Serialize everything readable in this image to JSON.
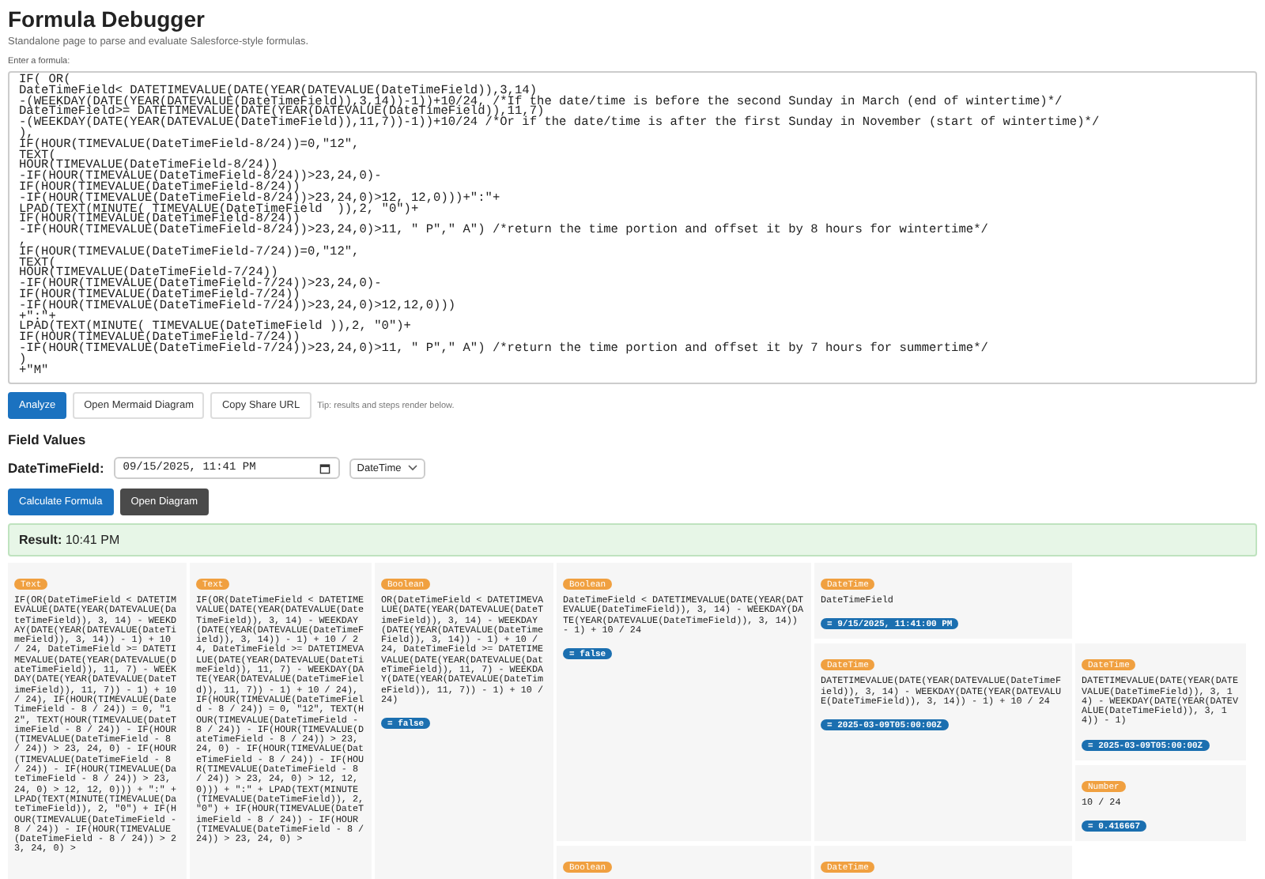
{
  "header": {
    "title": "Formula Debugger",
    "subtitle": "Standalone page to parse and evaluate Salesforce-style formulas."
  },
  "formula": {
    "label": "Enter a formula:",
    "value": "IF( OR(\nDateTimeField< DATETIMEVALUE(DATE(YEAR(DATEVALUE(DateTimeField)),3,14)\n-(WEEKDAY(DATE(YEAR(DATEVALUE(DateTimeField)),3,14))-1))+10/24, /*If the date/time is before the second Sunday in March (end of wintertime)*/\nDateTimeField>= DATETIMEVALUE(DATE(YEAR(DATEVALUE(DateTimeField)),11,7)\n-(WEEKDAY(DATE(YEAR(DATEVALUE(DateTimeField)),11,7))-1))+10/24 /*Or if the date/time is after the first Sunday in November (start of wintertime)*/\n),\nIF(HOUR(TIMEVALUE(DateTimeField-8/24))=0,\"12\",\nTEXT(\nHOUR(TIMEVALUE(DateTimeField-8/24))\n-IF(HOUR(TIMEVALUE(DateTimeField-8/24))>23,24,0)-\nIF(HOUR(TIMEVALUE(DateTimeField-8/24))\n-IF(HOUR(TIMEVALUE(DateTimeField-8/24))>23,24,0)>12, 12,0)))+\":\"+\nLPAD(TEXT(MINUTE( TIMEVALUE(DateTimeField  )),2, \"0\")+\nIF(HOUR(TIMEVALUE(DateTimeField-8/24))\n-IF(HOUR(TIMEVALUE(DateTimeField-8/24))>23,24,0)>11, \" P\",\" A\") /*return the time portion and offset it by 8 hours for wintertime*/\n,\nIF(HOUR(TIMEVALUE(DateTimeField-7/24))=0,\"12\",\nTEXT(\nHOUR(TIMEVALUE(DateTimeField-7/24))\n-IF(HOUR(TIMEVALUE(DateTimeField-7/24))>23,24,0)-\nIF(HOUR(TIMEVALUE(DateTimeField-7/24))\n-IF(HOUR(TIMEVALUE(DateTimeField-7/24))>23,24,0)>12,12,0)))\n+\":\"+\nLPAD(TEXT(MINUTE( TIMEVALUE(DateTimeField )),2, \"0\")+\nIF(HOUR(TIMEVALUE(DateTimeField-7/24))\n-IF(HOUR(TIMEVALUE(DateTimeField-7/24))>23,24,0)>11, \" P\",\" A\") /*return the time portion and offset it by 7 hours for summertime*/\n)\n+\"M\""
  },
  "actions": [
    {
      "label": "Analyze",
      "kind": "primary"
    },
    {
      "label": "Open Mermaid Diagram",
      "kind": "secondary"
    },
    {
      "label": "Copy Share URL",
      "kind": "secondary"
    }
  ],
  "tip": "Tip: results and steps render below.",
  "field_values": {
    "heading": "Field Values",
    "fields": [
      {
        "label": "DateTimeField:",
        "value": "09/15/2025, 11:41 PM",
        "type": "DateTime"
      }
    ]
  },
  "calc_buttons": [
    {
      "label": "Calculate Formula",
      "kind": "primary"
    },
    {
      "label": "Open Diagram",
      "kind": "dark"
    }
  ],
  "result": {
    "label": "Result:",
    "value": "10:41 PM"
  },
  "steps": {
    "type": "Text",
    "expression": "IF(OR(DateTimeField < DATETIMEVALUE(DATE(YEAR(DATEVALUE(DateTimeField)), 3, 14) - WEEKDAY(DATE(YEAR(DATEVALUE(DateTimeField)), 3, 14)) - 1) + 10 / 24, DateTimeField >= DATETIMEVALUE(DATE(YEAR(DATEVALUE(DateTimeField)), 11, 7) - WEEKDAY(DATE(YEAR(DATEVALUE(DateTimeField)), 11, 7)) - 1) + 10 / 24), IF(HOUR(TIMEVALUE(DateTimeField - 8 / 24)) = 0, \"12\", TEXT(HOUR(TIMEVALUE(DateTimeField - 8 / 24)) - IF(HOUR(TIMEVALUE(DateTimeField - 8 / 24)) > 23, 24, 0) - IF(HOUR(TIMEVALUE(DateTimeField - 8 / 24)) - IF(HOUR(TIMEVALUE(DateTimeField - 8 / 24)) > 23, 24, 0) > 12, 12, 0))) + \":\" + LPAD(TEXT(MINUTE(TIMEVALUE(DateTimeField)), 2, \"0\") + IF(HOUR(TIMEVALUE(DateTimeField - 8 / 24)) - IF(HOUR(TIMEVALUE(DateTimeField - 8 / 24)) > 23, 24, 0) >",
    "children": [
      {
        "type": "Text",
        "expression": "IF(OR(DateTimeField < DATETIMEVALUE(DATE(YEAR(DATEVALUE(DateTimeField)), 3, 14) - WEEKDAY(DATE(YEAR(DATEVALUE(DateTimeField)), 3, 14)) - 1) + 10 / 24, DateTimeField >= DATETIMEVALUE(DATE(YEAR(DATEVALUE(DateTimeField)), 11, 7) - WEEKDAY(DATE(YEAR(DATEVALUE(DateTimeField)), 11, 7)) - 1) + 10 / 24), IF(HOUR(TIMEVALUE(DateTimeField - 8 / 24)) = 0, \"12\", TEXT(HOUR(TIMEVALUE(DateTimeField - 8 / 24)) - IF(HOUR(TIMEVALUE(DateTimeField - 8 / 24)) > 23, 24, 0) - IF(HOUR(TIMEVALUE(DateTimeField - 8 / 24)) - IF(HOUR(TIMEVALUE(DateTimeField - 8 / 24)) > 23, 24, 0) > 12, 12, 0))) + \":\" + LPAD(TEXT(MINUTE(TIMEVALUE(DateTimeField)), 2, \"0\") + IF(HOUR(TIMEVALUE(DateTimeField - 8 / 24)) - IF(HOUR(TIMEVALUE(DateTimeField - 8 / 24)) > 23, 24, 0) >",
        "children": [
          {
            "type": "Boolean",
            "expression": "OR(DateTimeField < DATETIMEVALUE(DATE(YEAR(DATEVALUE(DateTimeField)), 3, 14) - WEEKDAY(DATE(YEAR(DATEVALUE(DateTimeField)), 3, 14)) - 1) + 10 / 24, DateTimeField >= DATETIMEVALUE(DATE(YEAR(DATEVALUE(DateTimeField)), 11, 7) - WEEKDAY(DATE(YEAR(DATEVALUE(DateTimeField)), 11, 7)) - 1) + 10 / 24)",
            "result": "= false",
            "children": [
              {
                "type": "Boolean",
                "expression": "DateTimeField < DATETIMEVALUE(DATE(YEAR(DATEVALUE(DateTimeField)), 3, 14) - WEEKDAY(DATE(YEAR(DATEVALUE(DateTimeField)), 3, 14)) - 1) + 10 / 24",
                "result": "= false",
                "children": [
                  {
                    "type": "DateTime",
                    "expression": "DateTimeField",
                    "result": "= 9/15/2025, 11:41:00 PM"
                  },
                  {
                    "type": "DateTime",
                    "expression": "DATETIMEVALUE(DATE(YEAR(DATEVALUE(DateTimeField)), 3, 14) - WEEKDAY(DATE(YEAR(DATEVALUE(DateTimeField)), 3, 14)) - 1) + 10 / 24",
                    "result": "= 2025-03-09T05:00:00Z",
                    "children": [
                      {
                        "type": "DateTime",
                        "expression": "DATETIMEVALUE(DATE(YEAR(DATEVALUE(DateTimeField)), 3, 14) - WEEKDAY(DATE(YEAR(DATEVALUE(DateTimeField)), 3, 14)) - 1)",
                        "result": "= 2025-03-09T05:00:00Z"
                      },
                      {
                        "type": "Number",
                        "expression": "10 / 24",
                        "result": "= 0.416667"
                      }
                    ]
                  }
                ]
              },
              {
                "type": "Boolean",
                "children": [
                  {
                    "type": "DateTime"
                  }
                ]
              }
            ]
          }
        ]
      }
    ]
  }
}
